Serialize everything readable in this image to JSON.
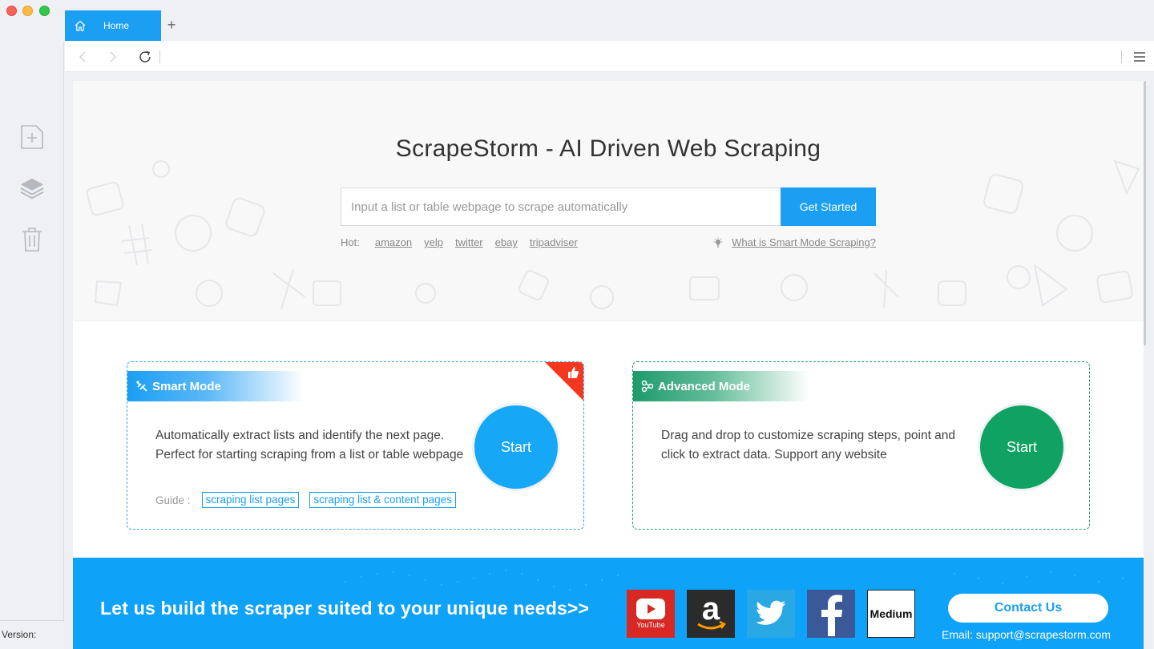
{
  "window": {
    "tab_label": "Home",
    "new_tab_glyph": "+",
    "version_label": "Version:"
  },
  "hero": {
    "title": "ScrapeStorm - AI Driven Web Scraping",
    "search_placeholder": "Input a list or table webpage to scrape automatically",
    "get_started_label": "Get Started",
    "hot_label": "Hot:",
    "hot_links": [
      "amazon",
      "yelp",
      "twitter",
      "ebay",
      "tripadviser"
    ],
    "smart_help_link": "What is Smart Mode Scraping?"
  },
  "smart_mode": {
    "title": "Smart Mode",
    "description": "Automatically extract lists and identify the next page. Perfect for starting scraping from a list or table webpage",
    "start_label": "Start",
    "guide_label": "Guide :",
    "guide_links": [
      "scraping list pages",
      "scraping list & content pages"
    ]
  },
  "advanced_mode": {
    "title": "Advanced Mode",
    "description": "Drag and drop to customize scraping steps, point and click to extract data. Support any website",
    "start_label": "Start"
  },
  "banner": {
    "headline": "Let us build the scraper suited to your unique needs>>",
    "youtube_label": "YouTube",
    "medium_label": "Medium",
    "contact_label": "Contact Us",
    "email": "Email: support@scrapestorm.com"
  },
  "colors": {
    "accent_blue": "#1a9ff3",
    "accent_green": "#10a262",
    "badge_red": "#f5371f"
  },
  "icons": [
    "home-icon",
    "plus-icon",
    "new-task-icon",
    "layers-icon",
    "trash-icon",
    "back-icon",
    "forward-icon",
    "reload-icon",
    "menu-icon",
    "lightbulb-icon",
    "smart-mode-icon",
    "advanced-mode-icon",
    "thumbs-up-icon",
    "youtube-icon",
    "amazon-icon",
    "twitter-icon",
    "facebook-icon"
  ]
}
